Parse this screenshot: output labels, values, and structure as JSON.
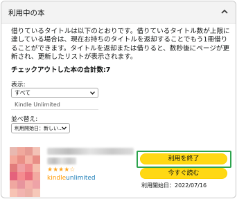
{
  "section": {
    "title": "利用中の本"
  },
  "description": "借りているタイトルは以下のとおりです。借りているタイトル数が上限に達している場合は、現在お持ちのタイトルを返却することでもう1冊借りることができます。タイトルを返却または借りると、数秒後にページが更新され、更新したリストが表示されます。",
  "total_label": "チェックアウトした本の合計数:7",
  "filters": {
    "display_label": "表示:",
    "display_selected": "すべて",
    "display_options": [
      "Kindle Unlimited"
    ],
    "sort_label": "並べ替え:",
    "sort_selected": "利用開始日：新しい..."
  },
  "book": {
    "rating": 4,
    "kindle_logo_part1": "kindle",
    "kindle_logo_part2": "unlimited",
    "return_button": "利用を終了",
    "read_button": "今すぐ読む",
    "start_date": "利用開始日：2022/07/16"
  },
  "colors": {
    "button_yellow": "#ffd814",
    "highlight_green": "#2da44e",
    "star_orange": "#ffa41c"
  }
}
